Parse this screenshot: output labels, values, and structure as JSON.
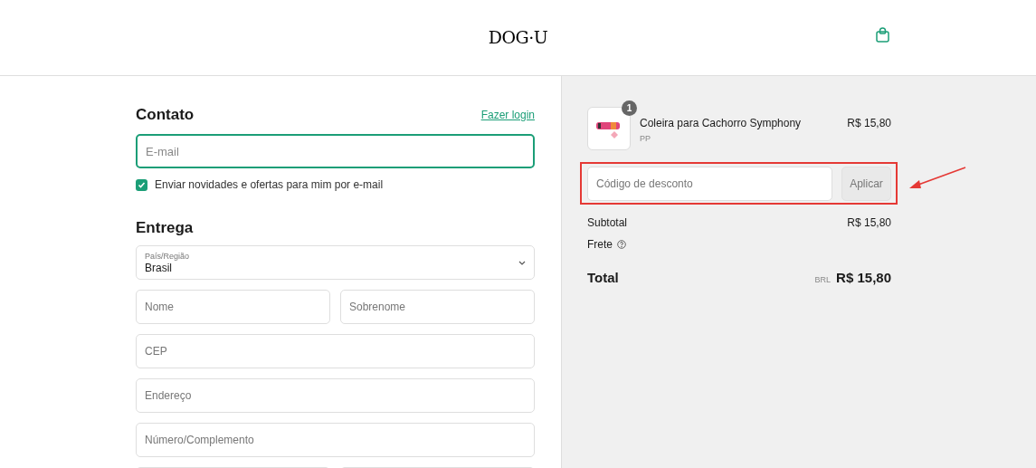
{
  "header": {
    "logo": "DOG·U"
  },
  "contact": {
    "title": "Contato",
    "login_link": "Fazer login",
    "email": {
      "placeholder": "E-mail",
      "focused": true
    },
    "newsletter": {
      "label": "Enviar novidades e ofertas para mim por e-mail",
      "checked": true
    }
  },
  "delivery": {
    "title": "Entrega",
    "fields": [
      {
        "kind": "select",
        "label": "País/Região",
        "value": "Brasil"
      },
      {
        "kind": "pair",
        "items": [
          {
            "placeholder": "Nome"
          },
          {
            "placeholder": "Sobrenome"
          }
        ]
      },
      {
        "kind": "text",
        "placeholder": "CEP"
      },
      {
        "kind": "text",
        "placeholder": "Endereço"
      },
      {
        "kind": "text",
        "placeholder": "Número/Complemento"
      },
      {
        "kind": "pair_cut"
      }
    ]
  },
  "summary": {
    "items": [
      {
        "quantity": "1",
        "name": "Coleira para Cachorro Symphony",
        "variant": "PP",
        "price": "R$ 15,80"
      }
    ],
    "discount": {
      "placeholder": "Código de desconto",
      "button": "Aplicar",
      "highlighted": true
    },
    "subtotal": {
      "label": "Subtotal",
      "value": "R$ 15,80"
    },
    "shipping": {
      "label": "Frete"
    },
    "total": {
      "label": "Total",
      "currency": "BRL",
      "value": "R$ 15,80"
    }
  }
}
